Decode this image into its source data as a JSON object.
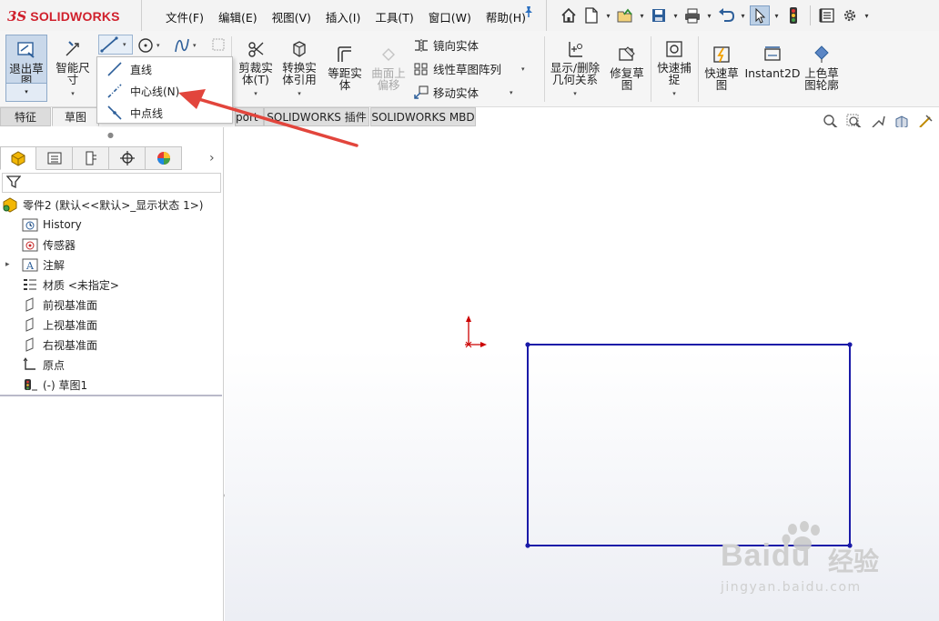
{
  "app": {
    "logo_prefix": "3S",
    "logo_text": "SOLIDWORKS"
  },
  "menu": {
    "items": [
      "文件(F)",
      "编辑(E)",
      "视图(V)",
      "插入(I)",
      "工具(T)",
      "窗口(W)",
      "帮助(H)"
    ]
  },
  "quickbar": {
    "icons": [
      "home-icon",
      "new-file-icon",
      "open-file-icon",
      "save-icon",
      "print-icon",
      "undo-icon",
      "select-cursor-icon",
      "traffic-light-icon",
      "file-properties-icon",
      "options-gear-icon"
    ]
  },
  "ribbon": {
    "exit_sketch": "退出草图",
    "smart_dim": "智能尺寸",
    "trim": "剪裁实体(T)",
    "convert": "转换实体引用",
    "offset": "等距实体",
    "surface_offset": "曲面上偏移",
    "mirror": "镜向实体",
    "linear_pattern": "线性草图阵列",
    "move": "移动实体",
    "relations": "显示/删除几何关系",
    "repair": "修复草图",
    "quick_snaps": "快速捕捉",
    "rapid_sketch": "快速草图",
    "instant2d": "Instant2D",
    "shaded_contours": "上色草图轮廓"
  },
  "tabs": {
    "feature": "特征",
    "sketch": "草图",
    "partial": "port",
    "plugins": "SOLIDWORKS 插件",
    "mbd": "SOLIDWORKS MBD"
  },
  "line_menu": {
    "line": "直线",
    "centerline": "中心线(N)",
    "midpoint_line": "中点线"
  },
  "tree": {
    "part": "零件2 (默认<<默认>_显示状态 1>)",
    "history": "History",
    "sensors": "传感器",
    "annotations": "注解",
    "material": "材质 <未指定>",
    "front_plane": "前视基准面",
    "top_plane": "上视基准面",
    "right_plane": "右视基准面",
    "origin": "原点",
    "sketch": "(-) 草图1"
  },
  "colors": {
    "accent_blue": "#1a1aa8",
    "logo_red": "#d0202c",
    "arrow_red": "#e2453c",
    "origin_red": "#cc0000"
  },
  "watermark": {
    "brand": "Baidu",
    "brand_cn": "经验",
    "url": "jingyan.baidu.com"
  }
}
